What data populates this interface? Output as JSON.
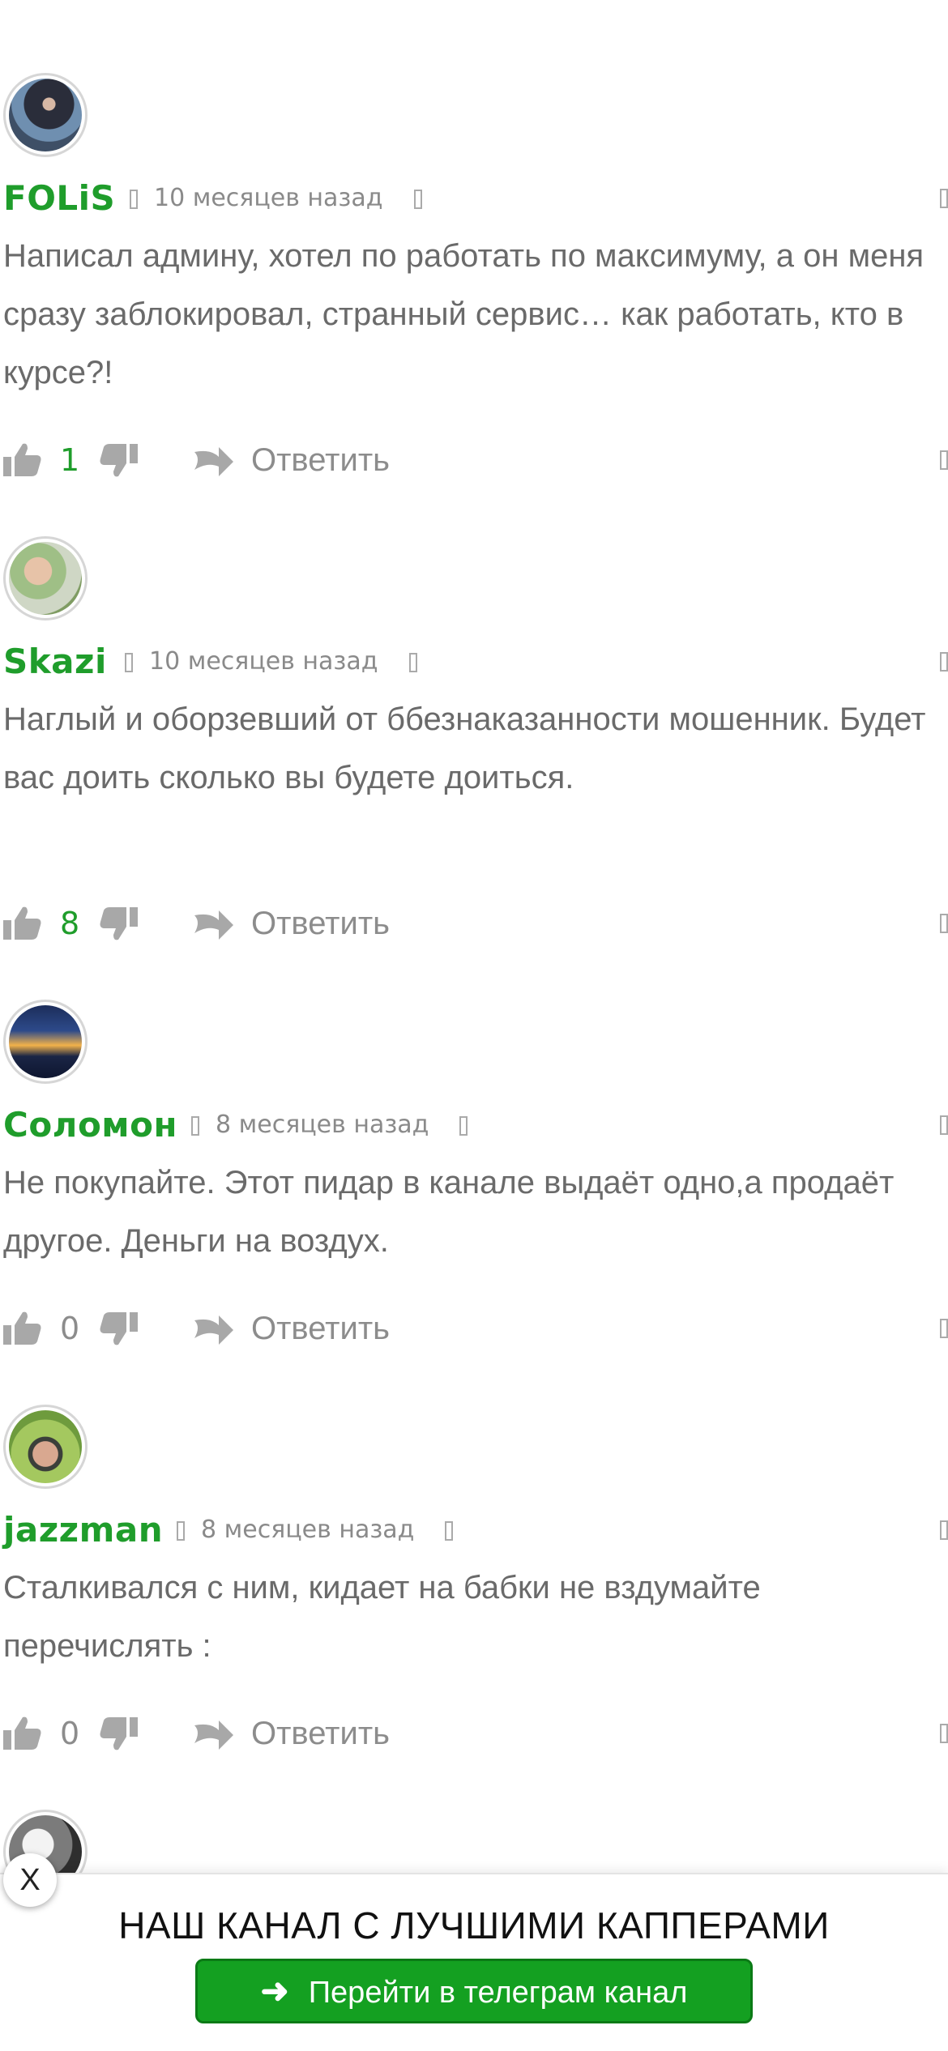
{
  "comments": [
    {
      "author": "FOLiS",
      "date": "10 месяцев назад",
      "text": "Написал админу, хотел по работать по максимуму, а он меня сразу заблокировал, странный сервис… как работать, кто в курсе?!",
      "votes": "1",
      "reply_label": "Ответить"
    },
    {
      "author": "Skazi",
      "date": "10 месяцев назад",
      "text": "Наглый и оборзевший от ббезнаказанности мошенник. Будет вас доить сколько вы будете доиться.",
      "votes": "8",
      "reply_label": "Ответить"
    },
    {
      "author": "Соломон",
      "date": "8 месяцев назад",
      "text": "Не покупайте. Этот пидар в канале выдаёт одно,а продаёт другое. Деньги на воздух.",
      "votes": "0",
      "reply_label": "Ответить"
    },
    {
      "author": "jazzman",
      "date": "8 месяцев назад",
      "text": "Сталкивался с ним, кидает на бабки не вздумайте перечислять :",
      "votes": "0",
      "reply_label": "Ответить"
    }
  ],
  "banner": {
    "close_label": "X",
    "title": "НАШ КАНАЛ С ЛУЧШИМИ КАППЕРАМИ",
    "button_label": "Перейти в телеграм канал",
    "button_arrow": "➜"
  },
  "colors": {
    "author": "#1f9d2b",
    "votes": "#1f9d2b",
    "button": "#14a021",
    "text": "#6a6a6a",
    "muted": "#8c8c8c"
  },
  "icons": {
    "like": "thumbs-up-icon",
    "dislike": "thumbs-down-icon",
    "reply": "reply-arrow-icon",
    "close": "close-icon",
    "arrow": "arrow-right-icon"
  }
}
